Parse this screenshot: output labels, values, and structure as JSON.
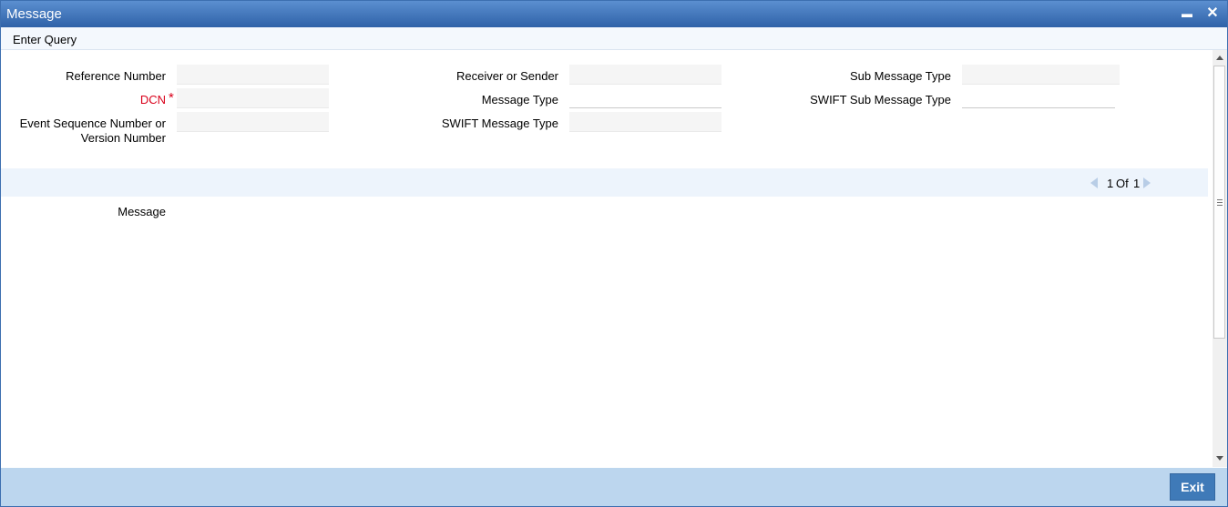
{
  "window": {
    "title": "Message",
    "minimize_label": "▬",
    "close_label": "✕"
  },
  "menu": {
    "items": [
      {
        "label": "Enter Query"
      }
    ]
  },
  "form": {
    "reference_number": {
      "label": "Reference Number",
      "value": ""
    },
    "dcn": {
      "label": "DCN",
      "required_mark": "*",
      "value": ""
    },
    "event_sequence": {
      "label_line1": "Event Sequence Number or",
      "label_line2": "Version Number",
      "value": ""
    },
    "receiver_or_sender": {
      "label": "Receiver or Sender",
      "value": ""
    },
    "message_type": {
      "label": "Message Type",
      "value": ""
    },
    "swift_message_type": {
      "label": "SWIFT Message Type",
      "value": ""
    },
    "sub_message_type": {
      "label": "Sub Message Type",
      "value": ""
    },
    "swift_sub_message_type": {
      "label": "SWIFT Sub Message Type",
      "value": ""
    }
  },
  "pager": {
    "current": "1",
    "of_label": "Of",
    "total": "1"
  },
  "message": {
    "label": "Message",
    "value": ""
  },
  "footer": {
    "exit_label": "Exit"
  },
  "colors": {
    "titlebar": "#3d6fb0",
    "required": "#d9001a",
    "footer": "#bcd6ee",
    "button": "#3f7ab8"
  }
}
